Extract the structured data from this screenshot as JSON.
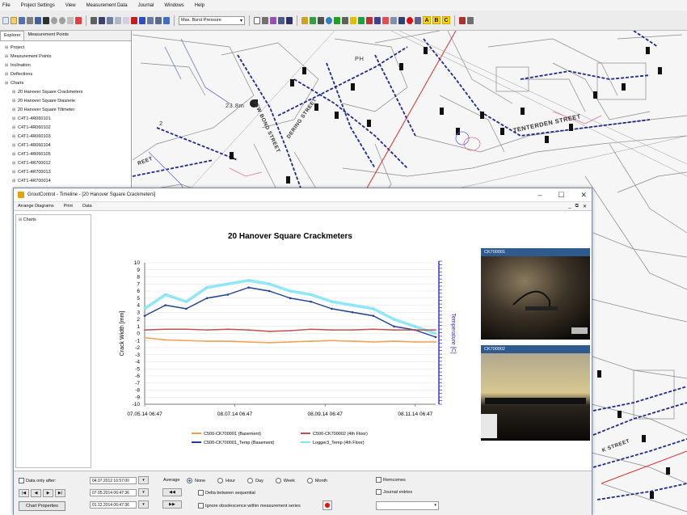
{
  "menu": [
    "File",
    "Project Settings",
    "View",
    "Measurement Data",
    "Journal",
    "Windows",
    "Help"
  ],
  "toolbar": {
    "measurement_select": "Max. Burst Pressure",
    "letter_buttons": [
      "A",
      "B",
      "C"
    ]
  },
  "explorer": {
    "tabs": [
      "Explorer",
      "Measurement Points"
    ],
    "items": [
      {
        "label": "Project",
        "level": 0
      },
      {
        "label": "Measurement Points",
        "level": 0
      },
      {
        "label": "Inclination",
        "level": 0
      },
      {
        "label": "Deflections",
        "level": 0
      },
      {
        "label": "Charts",
        "level": 0
      },
      {
        "label": "20 Hanover Square Crackmeters",
        "level": 1
      },
      {
        "label": "20 Hanover Square Diasnete",
        "level": 1
      },
      {
        "label": "20 Hanover Square Tiltmeter",
        "level": 1
      },
      {
        "label": "C4T1-4R060101",
        "level": 1
      },
      {
        "label": "C4T1-4R060102",
        "level": 1
      },
      {
        "label": "C4T1-4R060103",
        "level": 1
      },
      {
        "label": "C4T1-4R060104",
        "level": 1
      },
      {
        "label": "C4T1-4R060105",
        "level": 1
      },
      {
        "label": "C4T1-4R700012",
        "level": 1
      },
      {
        "label": "C4T1-4R700013",
        "level": 1
      },
      {
        "label": "C4T1-4R700014",
        "level": 1
      }
    ]
  },
  "map": {
    "streets": [
      "TENTERDEN STREET",
      "DERING STREET",
      "NEW BOND STREET",
      "REET",
      "K STREET"
    ],
    "label_23": "23.8m",
    "label_ph": "PH",
    "label_2": "2"
  },
  "window": {
    "title": "GroutControl - Timeline - [20 Hanover Square Crackmeters]",
    "menu": [
      "Arrange Diagrams",
      "Print",
      "Data"
    ],
    "tree_root": "Charts"
  },
  "photos": [
    {
      "caption": "CK700001"
    },
    {
      "caption": "CK700002"
    }
  ],
  "controls": {
    "data_only_after": "Data only after:",
    "date_after": "04.07.2012 16:57:00",
    "date_from": "07.05.2014 06:47:36",
    "date_to": "01.12.2014 06:47:36",
    "chart_properties": "Chart Properties",
    "average_label": "Average",
    "average_options": [
      "None",
      "Hour",
      "Day",
      "Week",
      "Month"
    ],
    "average_selected": "None",
    "delta_sequential": "Delta between sequential",
    "ignore_obsolescence": "Ignore obsolescence within measurement series",
    "remcomes": "Remcomes",
    "journal_entries": "Journal entries"
  },
  "chart_data": {
    "type": "line",
    "title": "20 Hanover Square Crackmeters",
    "ylabel": "Crack Width [mm]",
    "y2label": "Temperature [C]",
    "ylim": [
      -10,
      10
    ],
    "y_ticks": [
      10,
      9,
      8,
      7,
      6,
      5,
      4,
      3,
      2,
      1,
      0,
      -1,
      -2,
      -3,
      -4,
      -5,
      -6,
      -7,
      -8,
      -9,
      -10
    ],
    "x_ticks": [
      "07.05.14 06:47",
      "08.07.14 06:47",
      "08.09.14 06:47",
      "08.11.14 06:47"
    ],
    "grid": true,
    "legend_position": "bottom",
    "x": [
      0,
      15,
      30,
      45,
      60,
      75,
      90,
      105,
      120,
      135,
      150,
      165,
      180,
      195,
      210
    ],
    "series": [
      {
        "name": "C500-CK700001 (Basement)",
        "color": "#f0a050",
        "values": [
          -0.6,
          -0.9,
          -1.0,
          -1.1,
          -1.1,
          -1.2,
          -1.3,
          -1.2,
          -1.1,
          -1.0,
          -1.1,
          -1.2,
          -1.1,
          -1.2,
          -1.2
        ]
      },
      {
        "name": "C500-CK700002 (4th Floor)",
        "color": "#c0504d",
        "values": [
          0.5,
          0.6,
          0.6,
          0.5,
          0.6,
          0.5,
          0.3,
          0.4,
          0.6,
          0.5,
          0.5,
          0.6,
          0.5,
          0.5,
          0.5
        ]
      },
      {
        "name": "C500-CK700001_Temp (Basement)",
        "color": "#1f3f8f",
        "values": [
          2.5,
          4.0,
          3.5,
          5.0,
          5.5,
          6.5,
          6.0,
          5.0,
          4.5,
          3.5,
          3.0,
          2.5,
          1.0,
          0.5,
          -0.5
        ]
      },
      {
        "name": "Logger3_Temp (4th Floor)",
        "color": "#7fe3f5",
        "values": [
          3.5,
          5.5,
          4.5,
          6.5,
          7.0,
          7.5,
          7.0,
          6.0,
          5.5,
          4.5,
          4.0,
          3.5,
          2.0,
          1.0,
          0.0
        ]
      }
    ]
  }
}
